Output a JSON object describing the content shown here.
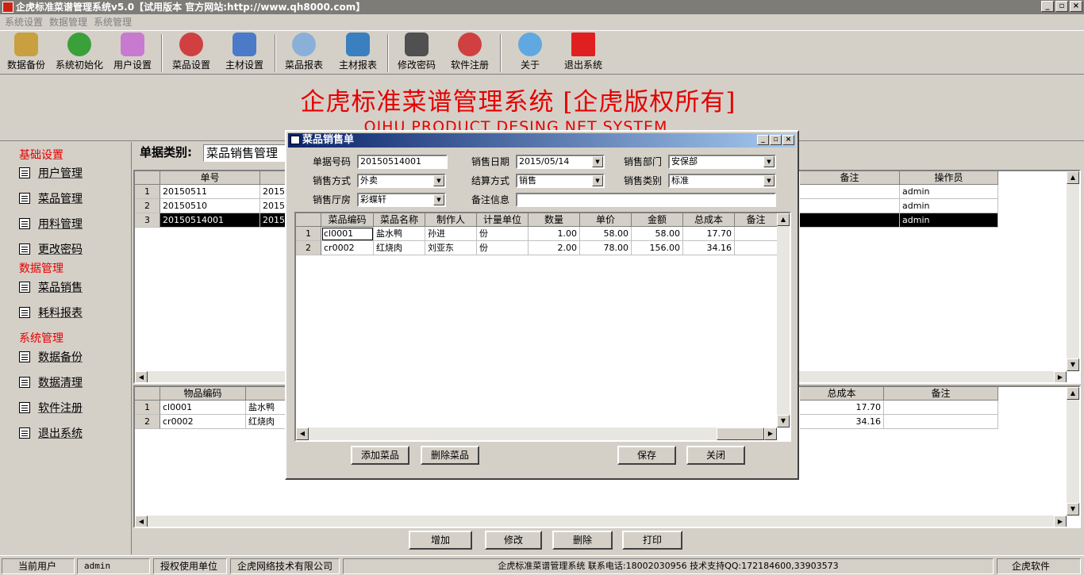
{
  "window": {
    "title": "企虎标准菜谱管理系统v5.0【试用版本 官方网站:http://www.qh8000.com】",
    "min": "_",
    "max": "▫",
    "close": "×"
  },
  "menu": [
    "系统设置",
    "数据管理",
    "系统管理"
  ],
  "toolbar": [
    {
      "label": "数据备份",
      "icon": "database-backup-icon",
      "color": "#c8a040"
    },
    {
      "label": "系统初始化",
      "icon": "refresh-icon",
      "color": "#3aa03a"
    },
    {
      "label": "用户设置",
      "icon": "user-face-icon",
      "color": "#c87ad0"
    },
    {
      "label": "菜品设置",
      "icon": "check-shield-icon",
      "color": "#d04040"
    },
    {
      "label": "主材设置",
      "icon": "edit-document-icon",
      "color": "#4a7ac8"
    },
    {
      "label": "菜品报表",
      "icon": "magnifier-icon",
      "color": "#8ab0d8"
    },
    {
      "label": "主材报表",
      "icon": "book-icon",
      "color": "#3a80c0"
    },
    {
      "label": "修改密码",
      "icon": "key-icon",
      "color": "#505050"
    },
    {
      "label": "软件注册",
      "icon": "check-shield-icon",
      "color": "#d04040"
    },
    {
      "label": "关于",
      "icon": "help-person-icon",
      "color": "#60a8e0"
    },
    {
      "label": "退出系统",
      "icon": "exit-cube-icon",
      "color": "#e02020"
    }
  ],
  "banner": {
    "title": "企虎标准菜谱管理系统 [企虎版权所有]",
    "subtitle": "QIHU PRODUCT DESING NET SYSTEM"
  },
  "sidebar": {
    "sections": [
      {
        "title": "基础设置",
        "items": [
          "用户管理",
          "菜品管理",
          "用料管理",
          "更改密码"
        ]
      },
      {
        "title": "数据管理",
        "items": [
          "菜品销售",
          "耗料报表"
        ]
      },
      {
        "title": "系统管理",
        "items": [
          "数据备份",
          "数据清理",
          "软件注册",
          "退出系统"
        ]
      }
    ]
  },
  "main": {
    "type_label": "单据类别:",
    "type_value": "菜品销售管理",
    "upper_grid": {
      "headers": {
        "no": "单号",
        "remark": "备注",
        "operator": "操作员"
      },
      "rows": [
        {
          "n": "1",
          "no": "20150511",
          "date": "2015/",
          "operator": "admin"
        },
        {
          "n": "2",
          "no": "20150510",
          "date": "2015/",
          "operator": "admin"
        },
        {
          "n": "3",
          "no": "20150514001",
          "date": "2015/",
          "operator": "admin"
        }
      ]
    },
    "lower_grid": {
      "headers": {
        "code": "物品编码",
        "cost": "总成本",
        "remark": "备注"
      },
      "rows": [
        {
          "n": "1",
          "code": "cl0001",
          "name": "盐水鸭",
          "cost": "17.70"
        },
        {
          "n": "2",
          "code": "cr0002",
          "name": "红烧肉",
          "cost": "34.16"
        }
      ]
    },
    "buttons": {
      "add": "增加",
      "edit": "修改",
      "delete": "删除",
      "print": "打印"
    }
  },
  "dialog": {
    "title": "菜品销售单",
    "fields": {
      "bill_no_label": "单据号码",
      "bill_no": "20150514001",
      "date_label": "销售日期",
      "date": "2015/05/14",
      "dept_label": "销售部门",
      "dept": "安保部",
      "mode_label": "销售方式",
      "mode": "外卖",
      "settle_label": "结算方式",
      "settle": "销售",
      "cat_label": "销售类别",
      "cat": "标准",
      "hall_label": "销售厅房",
      "hall": "彩蝶轩",
      "remark_label": "备注信息",
      "remark": ""
    },
    "grid": {
      "headers": [
        "菜品编码",
        "菜品名称",
        "制作人",
        "计量单位",
        "数量",
        "单价",
        "金额",
        "总成本",
        "备注"
      ],
      "rows": [
        {
          "n": "1",
          "code": "cl0001",
          "name": "盐水鸭",
          "maker": "孙进",
          "unit": "份",
          "qty": "1.00",
          "price": "58.00",
          "amount": "58.00",
          "cost": "17.70",
          "remark": ""
        },
        {
          "n": "2",
          "code": "cr0002",
          "name": "红烧肉",
          "maker": "刘亚东",
          "unit": "份",
          "qty": "2.00",
          "price": "78.00",
          "amount": "156.00",
          "cost": "34.16",
          "remark": ""
        }
      ]
    },
    "buttons": {
      "add": "添加菜品",
      "delete": "删除菜品",
      "save": "保存",
      "close": "关闭"
    }
  },
  "status": {
    "user_label": "当前用户",
    "user": "admin",
    "licensee_label": "授权使用单位",
    "licensee": "企虎网络技术有限公司",
    "info": "企虎标准菜谱管理系统   联系电话:18002030956  技术支持QQ:172184600,33903573",
    "brand": "企虎软件"
  }
}
